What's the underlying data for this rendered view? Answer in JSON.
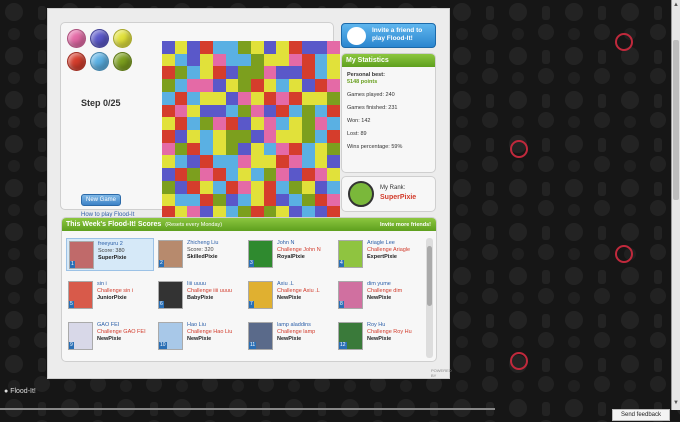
{
  "palette": [
    "#e46aa6",
    "#5a58c9",
    "#e1e13a",
    "#d53d2c",
    "#5ab0e3",
    "#7c9f1e"
  ],
  "board": {
    "rows": [
      "1213445212311",
      "24120445220342",
      "35423155011342",
      "54001253242130",
      "43422102303225",
      "30211450134543",
      "23450312042504",
      "31242551022543",
      "05342512403425",
      "24134402230421",
      "13503424501302",
      "51324302345214",
      "24435142314530",
      "32012453521413"
    ]
  },
  "controls": {
    "step_text": "Step 0/25",
    "new_game": "New Game",
    "howto": "How to play Flood-It"
  },
  "invite": {
    "label": "Invite a friend to play Flood-It!"
  },
  "stats": {
    "title": "My Statistics",
    "personal_best_label": "Personal best:",
    "personal_best_value": "5148 points",
    "games_played": "Games played: 240",
    "games_finished": "Games finished: 231",
    "won": "Won: 142",
    "lost": "Lost: 89",
    "wins_pct": "Wins percentage: 59%"
  },
  "rank": {
    "label": "My Rank:",
    "value": "SuperPixie"
  },
  "scores": {
    "title": "This Week's Flood-It! Scores",
    "subtitle": "(Resets every Monday)",
    "invite_more": "Invite more friends!",
    "players": [
      {
        "rank": "1",
        "name": "freeyuru 2",
        "line2": "Score: 380",
        "line3": "SuperPixie",
        "challenge": false,
        "color": "#c06a6a"
      },
      {
        "rank": "2",
        "name": "Zhicheng Liu",
        "line2": "Score: 320",
        "line3": "SkilledPixie",
        "challenge": false,
        "color": "#b78a6d"
      },
      {
        "rank": "3",
        "name": "John N",
        "line2": "Challenge John N",
        "line3": "RoyalPixie",
        "challenge": true,
        "color": "#2f8a2f"
      },
      {
        "rank": "4",
        "name": "Ariagle Lee",
        "line2": "Challenge Ariagle",
        "line3": "ExpertPixie",
        "challenge": true,
        "color": "#8fc440"
      },
      {
        "rank": "5",
        "name": "sin i",
        "line2": "Challenge sin i",
        "line3": "JuniorPixie",
        "challenge": true,
        "color": "#d85a4a"
      },
      {
        "rank": "6",
        "name": "Iiii uuuu",
        "line2": "Challenge iiii uuuu",
        "line3": "BabyPixie",
        "challenge": true,
        "color": "#333333"
      },
      {
        "rank": "7",
        "name": "Axiu .L",
        "line2": "Challenge Axiu .L",
        "line3": "NewPixie",
        "challenge": true,
        "color": "#e0b030"
      },
      {
        "rank": "8",
        "name": "dim yume",
        "line2": "Challenge dim",
        "line3": "NewPixie",
        "challenge": true,
        "color": "#d070a0"
      },
      {
        "rank": "9",
        "name": "GAO FEI",
        "line2": "Challenge GAO FEI",
        "line3": "NewPixie",
        "challenge": true,
        "color": "#d8d8e8"
      },
      {
        "rank": "10",
        "name": "Hao Liu",
        "line2": "Challenge Hao Liu",
        "line3": "NewPixie",
        "challenge": true,
        "color": "#a8c8e8"
      },
      {
        "rank": "11",
        "name": "lamp aladdins",
        "line2": "Challenge lamp",
        "line3": "NewPixie",
        "challenge": true,
        "color": "#5a6a8a"
      },
      {
        "rank": "12",
        "name": "Roy Hu",
        "line2": "Challenge Roy Hu",
        "line3": "NewPixie",
        "challenge": true,
        "color": "#3a7a3a"
      }
    ]
  },
  "powered": "POWERED BY",
  "footer": {
    "app": "Flood-It!",
    "feedback": "Send feedback"
  }
}
